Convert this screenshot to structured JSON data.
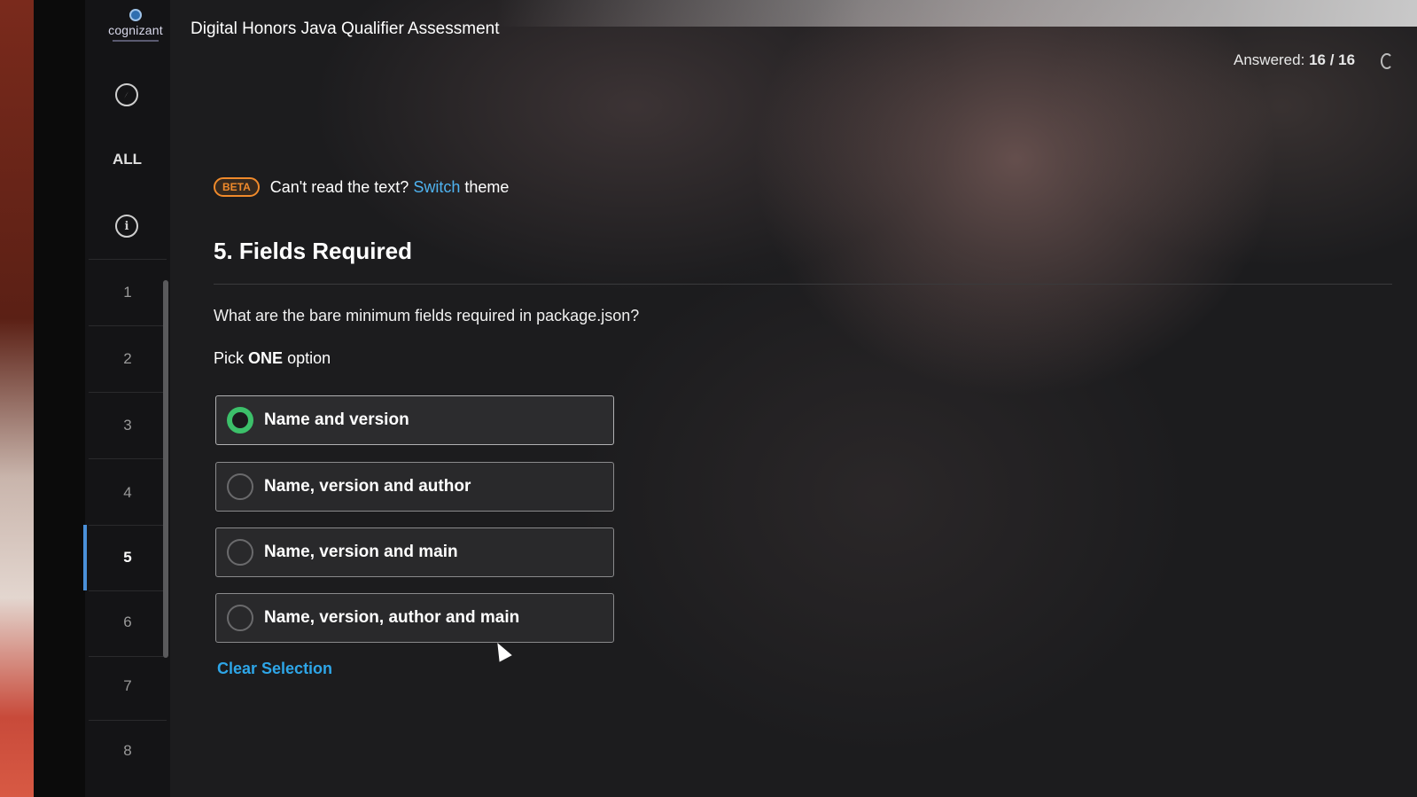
{
  "header": {
    "logo_text": "cognizant",
    "title": "Digital Honors Java Qualifier Assessment",
    "answered_label": "Answered:",
    "answered_value": "16 / 16"
  },
  "sidebar": {
    "icons": [
      "compass-icon",
      "info-icon"
    ],
    "all_label": "ALL",
    "questions": [
      "1",
      "2",
      "3",
      "4",
      "5",
      "6",
      "7",
      "8"
    ],
    "active_question": "5"
  },
  "beta_banner": {
    "badge": "BETA",
    "text": "Can't read the text?",
    "link": "Switch",
    "suffix": "theme"
  },
  "question": {
    "title": "5. Fields Required",
    "text": "What are the bare minimum fields required in package.json?",
    "pick_prefix": "Pick",
    "pick_emphasis": "ONE",
    "pick_suffix": "option",
    "options": [
      {
        "label": "Name and version",
        "selected": true
      },
      {
        "label": "Name, version and author",
        "selected": false
      },
      {
        "label": "Name, version and main",
        "selected": false
      },
      {
        "label": "Name, version, author and main",
        "selected": false
      }
    ],
    "clear_label": "Clear Selection"
  },
  "colors": {
    "accent_link": "#4fb3f0",
    "beta_orange": "#f08a2b",
    "radio_selected": "#3cc06a",
    "active_indicator": "#4a90d9"
  }
}
